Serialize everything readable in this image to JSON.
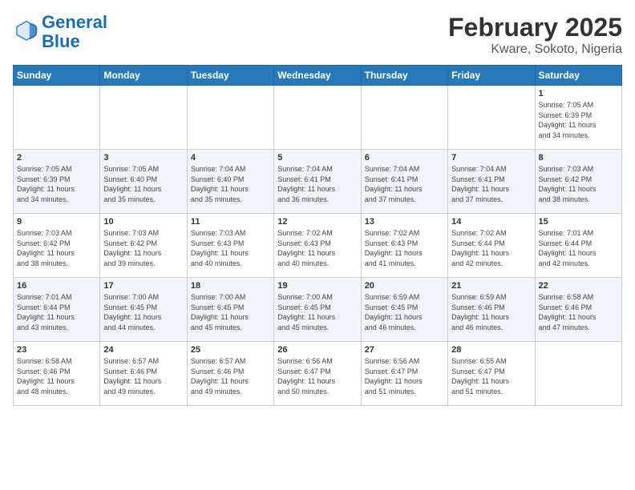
{
  "header": {
    "logo_line1": "General",
    "logo_line2": "Blue",
    "title": "February 2025",
    "subtitle": "Kware, Sokoto, Nigeria"
  },
  "days_of_week": [
    "Sunday",
    "Monday",
    "Tuesday",
    "Wednesday",
    "Thursday",
    "Friday",
    "Saturday"
  ],
  "weeks": [
    [
      {
        "day": "",
        "info": ""
      },
      {
        "day": "",
        "info": ""
      },
      {
        "day": "",
        "info": ""
      },
      {
        "day": "",
        "info": ""
      },
      {
        "day": "",
        "info": ""
      },
      {
        "day": "",
        "info": ""
      },
      {
        "day": "1",
        "info": "Sunrise: 7:05 AM\nSunset: 6:39 PM\nDaylight: 11 hours\nand 34 minutes."
      }
    ],
    [
      {
        "day": "2",
        "info": "Sunrise: 7:05 AM\nSunset: 6:39 PM\nDaylight: 11 hours\nand 34 minutes."
      },
      {
        "day": "3",
        "info": "Sunrise: 7:05 AM\nSunset: 6:40 PM\nDaylight: 11 hours\nand 35 minutes."
      },
      {
        "day": "4",
        "info": "Sunrise: 7:04 AM\nSunset: 6:40 PM\nDaylight: 11 hours\nand 35 minutes."
      },
      {
        "day": "5",
        "info": "Sunrise: 7:04 AM\nSunset: 6:41 PM\nDaylight: 11 hours\nand 36 minutes."
      },
      {
        "day": "6",
        "info": "Sunrise: 7:04 AM\nSunset: 6:41 PM\nDaylight: 11 hours\nand 37 minutes."
      },
      {
        "day": "7",
        "info": "Sunrise: 7:04 AM\nSunset: 6:41 PM\nDaylight: 11 hours\nand 37 minutes."
      },
      {
        "day": "8",
        "info": "Sunrise: 7:03 AM\nSunset: 6:42 PM\nDaylight: 11 hours\nand 38 minutes."
      }
    ],
    [
      {
        "day": "9",
        "info": "Sunrise: 7:03 AM\nSunset: 6:42 PM\nDaylight: 11 hours\nand 38 minutes."
      },
      {
        "day": "10",
        "info": "Sunrise: 7:03 AM\nSunset: 6:42 PM\nDaylight: 11 hours\nand 39 minutes."
      },
      {
        "day": "11",
        "info": "Sunrise: 7:03 AM\nSunset: 6:43 PM\nDaylight: 11 hours\nand 40 minutes."
      },
      {
        "day": "12",
        "info": "Sunrise: 7:02 AM\nSunset: 6:43 PM\nDaylight: 11 hours\nand 40 minutes."
      },
      {
        "day": "13",
        "info": "Sunrise: 7:02 AM\nSunset: 6:43 PM\nDaylight: 11 hours\nand 41 minutes."
      },
      {
        "day": "14",
        "info": "Sunrise: 7:02 AM\nSunset: 6:44 PM\nDaylight: 11 hours\nand 42 minutes."
      },
      {
        "day": "15",
        "info": "Sunrise: 7:01 AM\nSunset: 6:44 PM\nDaylight: 11 hours\nand 42 minutes."
      }
    ],
    [
      {
        "day": "16",
        "info": "Sunrise: 7:01 AM\nSunset: 6:44 PM\nDaylight: 11 hours\nand 43 minutes."
      },
      {
        "day": "17",
        "info": "Sunrise: 7:00 AM\nSunset: 6:45 PM\nDaylight: 11 hours\nand 44 minutes."
      },
      {
        "day": "18",
        "info": "Sunrise: 7:00 AM\nSunset: 6:45 PM\nDaylight: 11 hours\nand 45 minutes."
      },
      {
        "day": "19",
        "info": "Sunrise: 7:00 AM\nSunset: 6:45 PM\nDaylight: 11 hours\nand 45 minutes."
      },
      {
        "day": "20",
        "info": "Sunrise: 6:59 AM\nSunset: 6:45 PM\nDaylight: 11 hours\nand 46 minutes."
      },
      {
        "day": "21",
        "info": "Sunrise: 6:59 AM\nSunset: 6:46 PM\nDaylight: 11 hours\nand 46 minutes."
      },
      {
        "day": "22",
        "info": "Sunrise: 6:58 AM\nSunset: 6:46 PM\nDaylight: 11 hours\nand 47 minutes."
      }
    ],
    [
      {
        "day": "23",
        "info": "Sunrise: 6:58 AM\nSunset: 6:46 PM\nDaylight: 11 hours\nand 48 minutes."
      },
      {
        "day": "24",
        "info": "Sunrise: 6:57 AM\nSunset: 6:46 PM\nDaylight: 11 hours\nand 49 minutes."
      },
      {
        "day": "25",
        "info": "Sunrise: 6:57 AM\nSunset: 6:46 PM\nDaylight: 11 hours\nand 49 minutes."
      },
      {
        "day": "26",
        "info": "Sunrise: 6:56 AM\nSunset: 6:47 PM\nDaylight: 11 hours\nand 50 minutes."
      },
      {
        "day": "27",
        "info": "Sunrise: 6:56 AM\nSunset: 6:47 PM\nDaylight: 11 hours\nand 51 minutes."
      },
      {
        "day": "28",
        "info": "Sunrise: 6:55 AM\nSunset: 6:47 PM\nDaylight: 11 hours\nand 51 minutes."
      },
      {
        "day": "",
        "info": ""
      }
    ]
  ]
}
